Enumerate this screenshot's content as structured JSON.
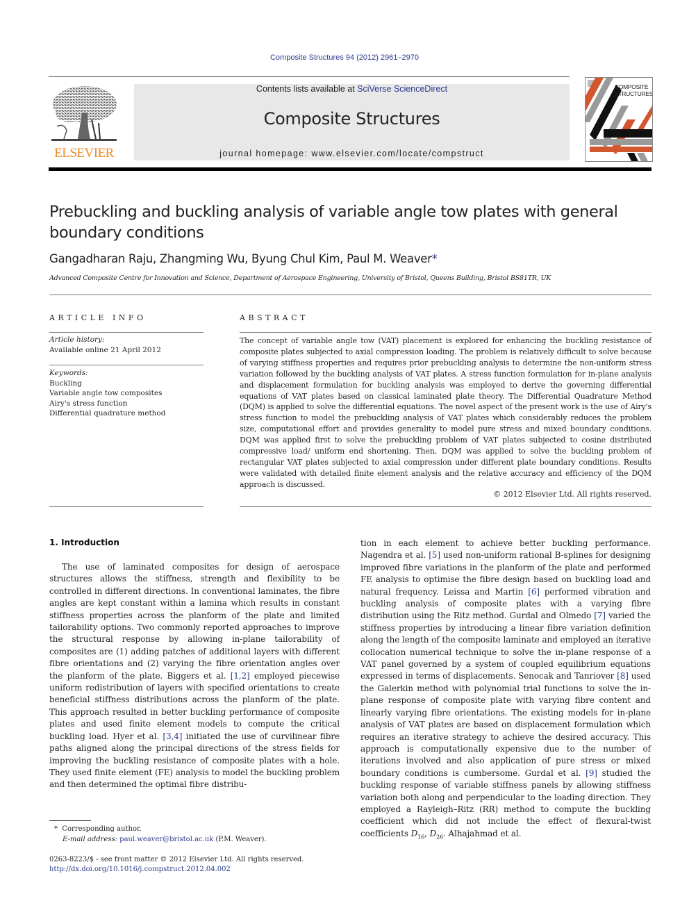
{
  "header": {
    "journal_ref": "Composite Structures 94 (2012) 2961–2970",
    "contents_prefix": "Contents lists available at ",
    "contents_link": "SciVerse ScienceDirect",
    "journal_title": "Composite Structures",
    "homepage_prefix": "journal homepage: ",
    "homepage_url": "www.elsevier.com/locate/compstruct",
    "publisher_logo_text": "ELSEVIER",
    "cover_title_line1": "COMPOSITE",
    "cover_title_line2": "STRUCTURES",
    "colors": {
      "link": "#2b3a8c",
      "elsevier_orange": "#f08a24",
      "cover_orange": "#d2562e",
      "cover_grey": "#9a9a9a"
    }
  },
  "article": {
    "title": "Prebuckling and buckling analysis of variable angle tow plates with general boundary conditions",
    "authors": "Gangadharan Raju, Zhangming Wu, Byung Chul Kim, Paul M. Weaver",
    "author_mark": "*",
    "affiliation": "Advanced Composite Centre for Innovation and Science, Department of Aerospace Engineering, University of Bristol, Queens Building, Bristol BS81TR, UK"
  },
  "article_info": {
    "heading": "ARTICLE INFO",
    "history_label": "Article history:",
    "history_value": "Available online 21 April 2012",
    "keywords_label": "Keywords:",
    "keywords": [
      "Buckling",
      "Variable angle tow composites",
      "Airy's stress function",
      "Differential quadrature method"
    ]
  },
  "abstract": {
    "heading": "ABSTRACT",
    "text": "The concept of variable angle tow (VAT) placement is explored for enhancing the buckling resistance of composite plates subjected to axial compression loading. The problem is relatively difficult to solve because of varying stiffness properties and requires prior prebuckling analysis to determine the non-uniform stress variation followed by the buckling analysis of VAT plates. A stress function formulation for in-plane analysis and displacement formulation for buckling analysis was employed to derive the governing differential equations of VAT plates based on classical laminated plate theory. The Differential Quadrature Method (DQM) is applied to solve the differential equations. The novel aspect of the present work is the use of Airy's stress function to model the prebuckling analysis of VAT plates which considerably reduces the problem size, computational effort and provides generality to model pure stress and mixed boundary conditions. DQM was applied first to solve the prebuckling problem of VAT plates subjected to cosine distributed compressive load/ uniform end shortening. Then, DQM was applied to solve the buckling problem of rectangular VAT plates subjected to axial compression under different plate boundary conditions. Results were validated with detailed finite element analysis and the relative accuracy and efficiency of the DQM approach is discussed.",
    "copyright": "© 2012 Elsevier Ltd. All rights reserved."
  },
  "intro": {
    "heading": "1. Introduction",
    "left": [
      {
        "t": "The use of laminated composites for design of aerospace structures allows the stiffness, strength and flexibility to be controlled in different directions. In conventional laminates, the fibre angles are kept constant within a lamina which results in constant stiffness properties across the planform of the plate and limited tailorability options. Two commonly reported approaches to improve the structural response by allowing in-plane tailorability of composites are (1) adding patches of additional layers with different fibre orientations and (2) varying the fibre orientation angles over the planform of the plate. Biggers et al. "
      },
      {
        "ref": "[1,2]"
      },
      {
        "t": " employed piecewise uniform redistribution of layers with specified orientations to create beneficial stiffness distributions across the planform of the plate. This approach resulted in better buckling performance of composite plates and used finite element models to compute the critical buckling load. Hyer et al. "
      },
      {
        "ref": "[3,4]"
      },
      {
        "t": " initiated the use of curvilinear fibre paths aligned along the principal directions of the stress fields for improving the buckling resistance of composite plates with a hole. They used finite element (FE) analysis to model the buckling problem and then determined the optimal fibre distribu-"
      }
    ],
    "right": [
      {
        "t": "tion in each element to achieve better buckling performance. Nagendra et al. "
      },
      {
        "ref": "[5]"
      },
      {
        "t": " used non-uniform rational B-splines for designing improved fibre variations in the planform of the plate and performed FE analysis to optimise the fibre design based on buckling load and natural frequency. Leissa and Martin "
      },
      {
        "ref": "[6]"
      },
      {
        "t": " performed vibration and buckling analysis of composite plates with a varying fibre distribution using the Ritz method. Gurdal and Olmedo "
      },
      {
        "ref": "[7]"
      },
      {
        "t": " varied the stiffness properties by introducing a linear fibre variation definition along the length of the composite laminate and employed an iterative collocation numerical technique to solve the in-plane response of a VAT panel governed by a system of coupled equilibrium equations expressed in terms of displacements. Senocak and Tanriover "
      },
      {
        "ref": "[8]"
      },
      {
        "t": " used the Galerkin method with polynomial trial functions to solve the in-plane response of composite plate with varying fibre content and linearly varying fibre orientations. The existing models for in-plane analysis of VAT plates are based on displacement formulation which requires an iterative strategy to achieve the desired accuracy. This approach is computationally expensive due to the number of iterations involved and also application of pure stress or mixed boundary conditions is cumbersome. Gurdal et al. "
      },
      {
        "ref": "[9]"
      },
      {
        "t": " studied the buckling response of variable stiffness panels by allowing stiffness variation both along and perpendicular to the loading direction. They employed a Rayleigh–Ritz (RR) method to compute the buckling coefficient which did not include the effect of flexural-twist coefficients "
      },
      {
        "math": "D",
        "sub": "16"
      },
      {
        "t": ", "
      },
      {
        "math": "D",
        "sub": "26"
      },
      {
        "t": ". Alhajahmad et al."
      }
    ]
  },
  "footnotes": {
    "star": "*",
    "corresponding": "Corresponding author.",
    "email_label": "E-mail address:",
    "email": "paul.weaver@bristol.ac.uk",
    "email_suffix": " (P.M. Weaver).",
    "issn": "0263-8223/$ - see front matter © 2012 Elsevier Ltd. All rights reserved.",
    "doi": "http://dx.doi.org/10.1016/j.compstruct.2012.04.002"
  }
}
